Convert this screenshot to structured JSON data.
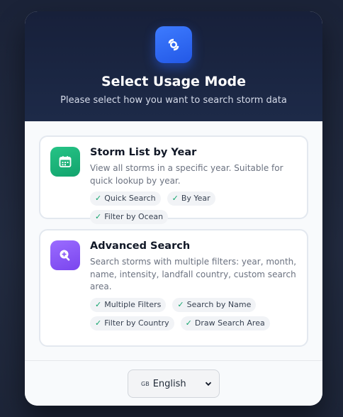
{
  "header": {
    "title": "Select Usage Mode",
    "subtitle": "Please select how you want to search storm data",
    "logo_icon": "storm-swirl-icon"
  },
  "modes": [
    {
      "icon": "calendar-icon",
      "title": "Storm List by Year",
      "description": "View all storms in a specific year. Suitable for quick lookup by year.",
      "tags": [
        "Quick Search",
        "By Year",
        "Filter by Ocean"
      ]
    },
    {
      "icon": "zoom-in-icon",
      "title": "Advanced Search",
      "description": "Search storms with multiple filters: year, month, name, intensity, landfall country, custom search area.",
      "tags": [
        "Multiple Filters",
        "Search by Name",
        "Filter by Country",
        "Draw Search Area"
      ]
    }
  ],
  "footer": {
    "language_flag": "GB",
    "language_label": "English"
  },
  "colors": {
    "header_bg": "#17203a",
    "accent_blue": "#2f6bff",
    "green": "#12a36d",
    "purple": "#8b5cf6",
    "check": "#10a36b"
  }
}
